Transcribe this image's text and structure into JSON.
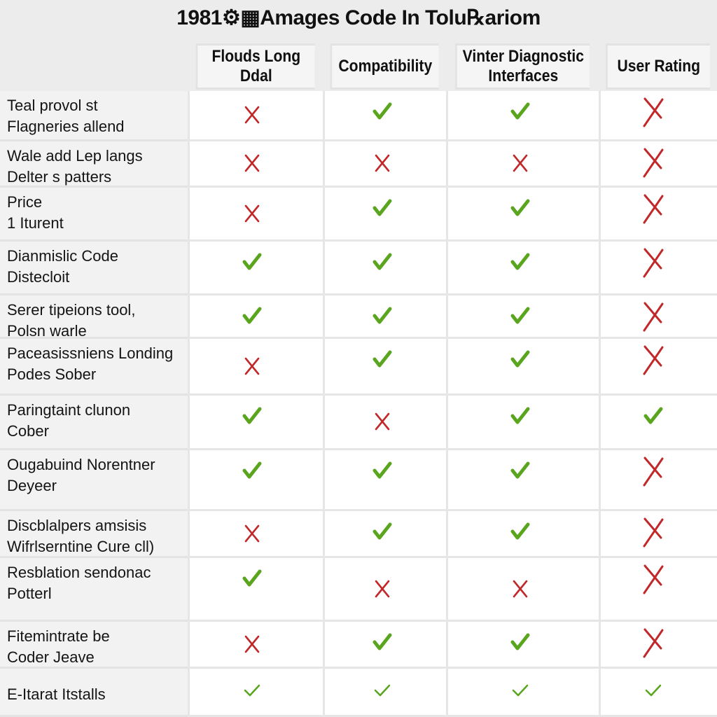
{
  "title": "1981⚙▦Amages Code In Tolu℞ariom",
  "colors": {
    "check": "#5aa51e",
    "cross": "#c0282a",
    "header_bg": "#f5f5f5",
    "label_bg": "#f2f2f2",
    "cell_bg": "#ffffff",
    "grid": "#e4e4e4"
  },
  "columns": [
    {
      "label_line1": "Flouds Long",
      "label_line2": "Ddal"
    },
    {
      "label_line1": "Compatibility",
      "label_line2": ""
    },
    {
      "label_line1": "Vinter Diagnostic",
      "label_line2": "Interfaces"
    },
    {
      "label_line1": "User Rating",
      "label_line2": ""
    }
  ],
  "rows": [
    {
      "label": "Teal provol st\nFlagneries allend",
      "values": [
        "cross",
        "check",
        "check",
        "cross"
      ]
    },
    {
      "label": "Wale add Lep langs\nDelter s patters",
      "values": [
        "cross",
        "cross",
        "cross",
        "cross"
      ]
    },
    {
      "label": "Price\n1 Iturent",
      "values": [
        "cross",
        "check",
        "check",
        "cross"
      ]
    },
    {
      "label": "Dianmislic Code\nDistecloit",
      "values": [
        "check",
        "check",
        "check",
        "cross"
      ]
    },
    {
      "label": "Serer tipeions tool,\nPolsn warle",
      "values": [
        "check",
        "check",
        "check",
        "cross"
      ]
    },
    {
      "label": "Paceasissniens Londing\nPodes Sober",
      "values": [
        "cross",
        "check",
        "check",
        "cross"
      ]
    },
    {
      "label": "Paringtaint clunon\nCober",
      "values": [
        "check",
        "cross",
        "check",
        "check"
      ]
    },
    {
      "label": "Ougabuind Norentner\nDeyeer",
      "values": [
        "check",
        "check",
        "check",
        "cross"
      ]
    },
    {
      "label": "Discblalpers amsisis\nWifrlserntine Cure cll)",
      "values": [
        "cross",
        "check",
        "check",
        "cross"
      ]
    },
    {
      "label": "Resblation sendonac\nPotterl",
      "values": [
        "check",
        "cross",
        "cross",
        "cross"
      ]
    },
    {
      "label": "Fitemintrate be\nCoder Jeave",
      "values": [
        "cross",
        "check",
        "check",
        "cross"
      ]
    },
    {
      "label": "E-Itarat Itstalls",
      "values": [
        "check-thin",
        "check-thin",
        "check-thin",
        "check-thin"
      ]
    }
  ]
}
